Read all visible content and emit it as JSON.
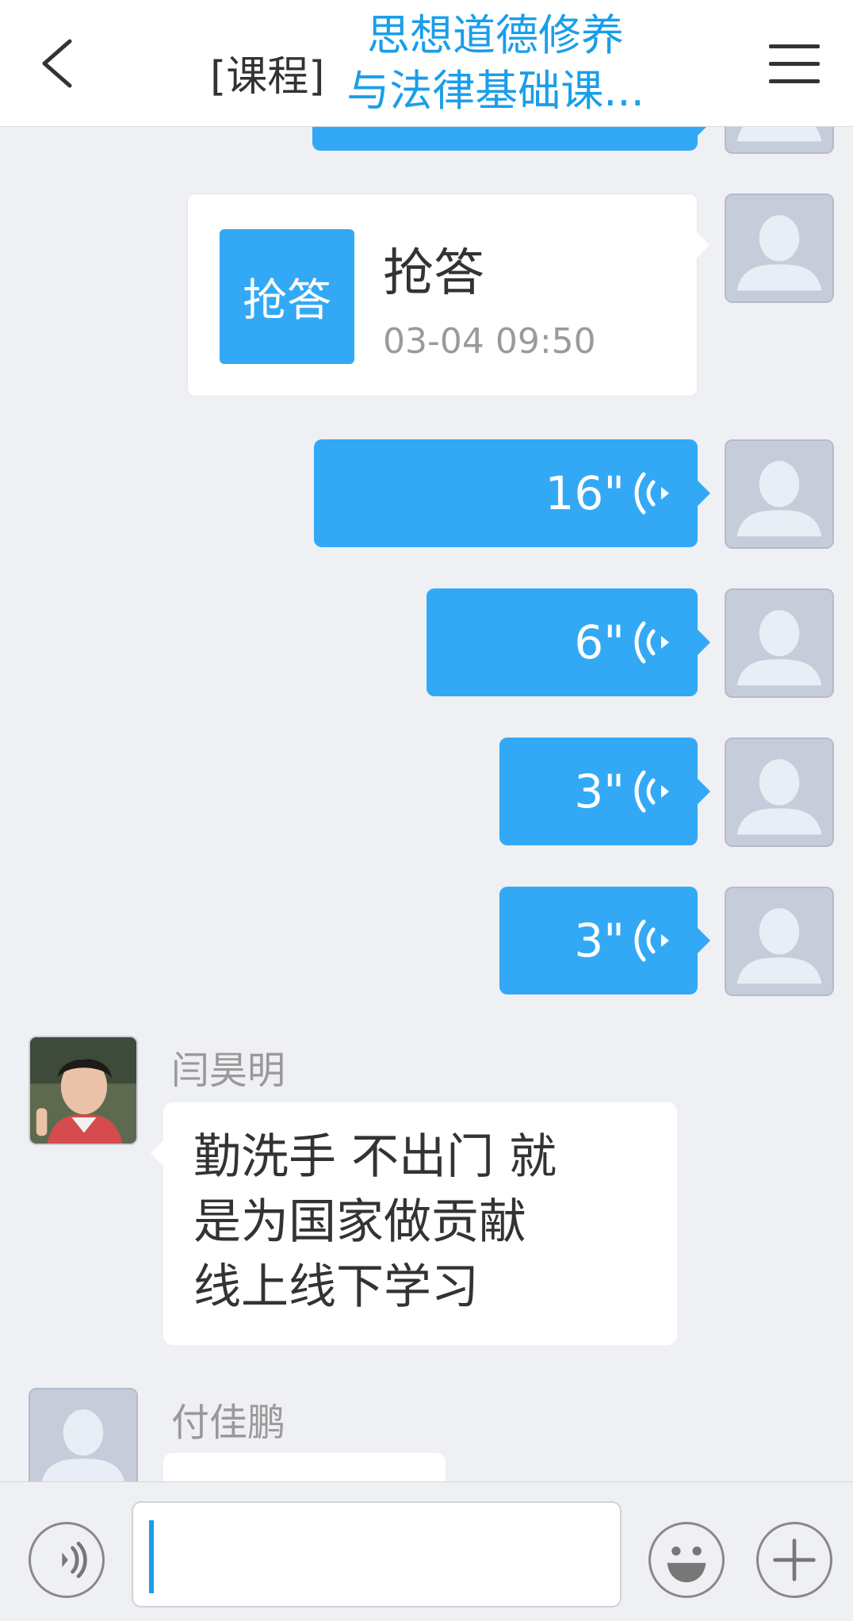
{
  "header": {
    "title_prefix": "[课程]",
    "title_line1": "思想道德修养",
    "title_line2": "与法律基础课..."
  },
  "card": {
    "badge": "抢答",
    "title": "抢答",
    "time": "03-04 09:50"
  },
  "voice_messages": [
    {
      "duration": "16\""
    },
    {
      "duration": "6\""
    },
    {
      "duration": "3\""
    },
    {
      "duration": "3\""
    }
  ],
  "incoming": [
    {
      "name": "闫昊明",
      "lines": [
        "勤洗手 不出门 就",
        "是为国家做贡献",
        "线上线下学习"
      ]
    },
    {
      "name": "付佳鹏"
    }
  ],
  "input": {
    "value": "",
    "placeholder": ""
  },
  "icons": {
    "back": "chevron-left-icon",
    "menu": "hamburger-menu-icon",
    "voice": "voice-wave-icon",
    "voice_toggle": "voice-input-icon",
    "emoji": "emoji-icon",
    "add": "plus-icon",
    "avatar": "default-avatar-icon"
  },
  "colors": {
    "accent": "#33a9f6",
    "title": "#1a9ee9",
    "background": "#eef0f4"
  }
}
